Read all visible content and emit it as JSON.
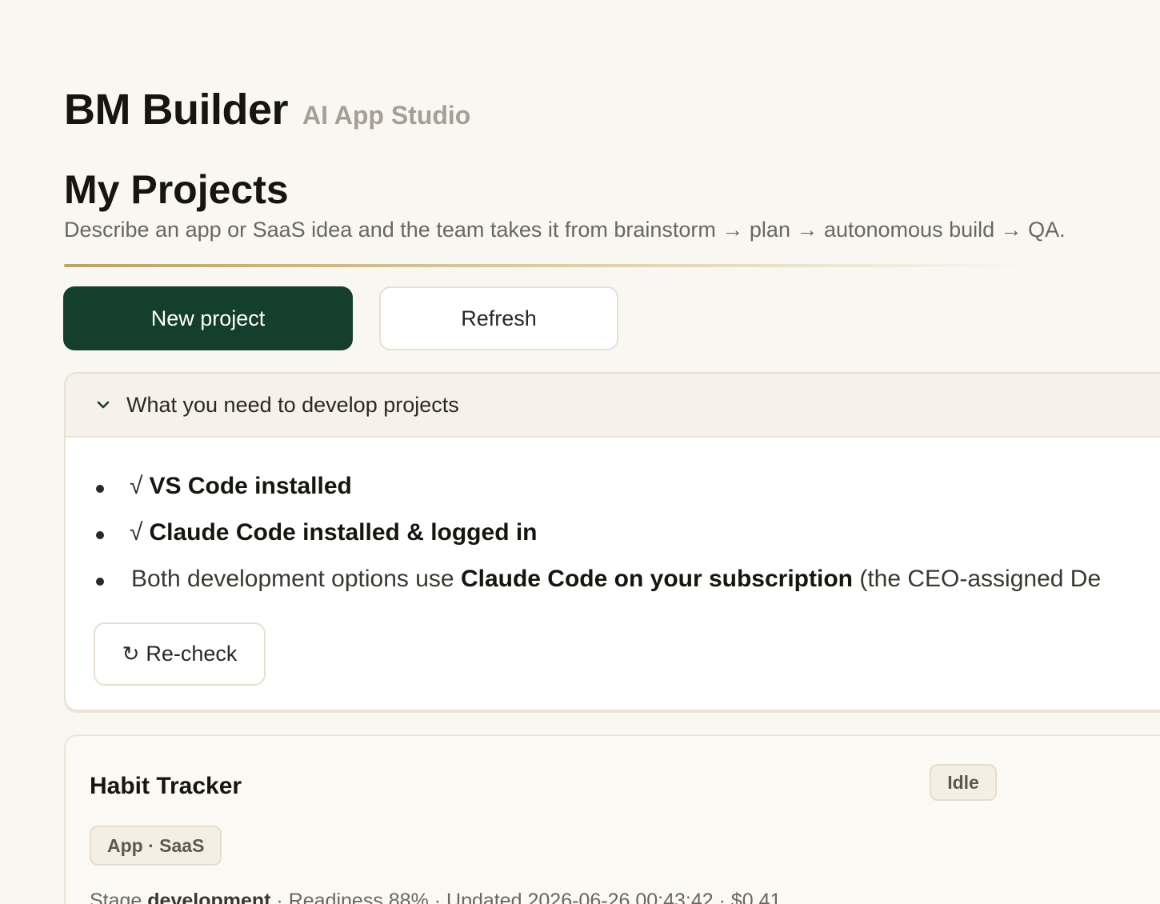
{
  "brand": {
    "name": "BM Builder",
    "tagline": "AI App Studio"
  },
  "page": {
    "title": "My Projects",
    "subtitle": "Describe an app or SaaS idea and the team takes it from brainstorm → plan → autonomous build → QA."
  },
  "toolbar": {
    "new_project_label": "New project",
    "refresh_label": "Refresh"
  },
  "requirements": {
    "header": "What you need to develop projects",
    "expanded": true,
    "items": [
      {
        "check": "√",
        "text": "VS Code installed"
      },
      {
        "check": "√",
        "text": "Claude Code installed & logged in"
      },
      {
        "prefix": "Both development options use ",
        "emphasis": "Claude Code on your subscription",
        "suffix": " (the CEO-assigned De"
      }
    ],
    "recheck_icon": "↻",
    "recheck_label": "Re-check"
  },
  "projects": [
    {
      "name": "Habit Tracker",
      "status": "Idle",
      "type": "App · SaaS",
      "meta": {
        "stage_label": "Stage ",
        "stage": "development",
        "readiness": " · Readiness 88% · Updated 2026-06-26 00:43:42 · $0.41"
      }
    }
  ],
  "icons": {
    "expand": "chevron-down-icon",
    "recheck": "refresh-icon"
  },
  "colors": {
    "primary": "#143f2c",
    "background": "#f9f7f1",
    "accent_rule": "#bba369"
  }
}
